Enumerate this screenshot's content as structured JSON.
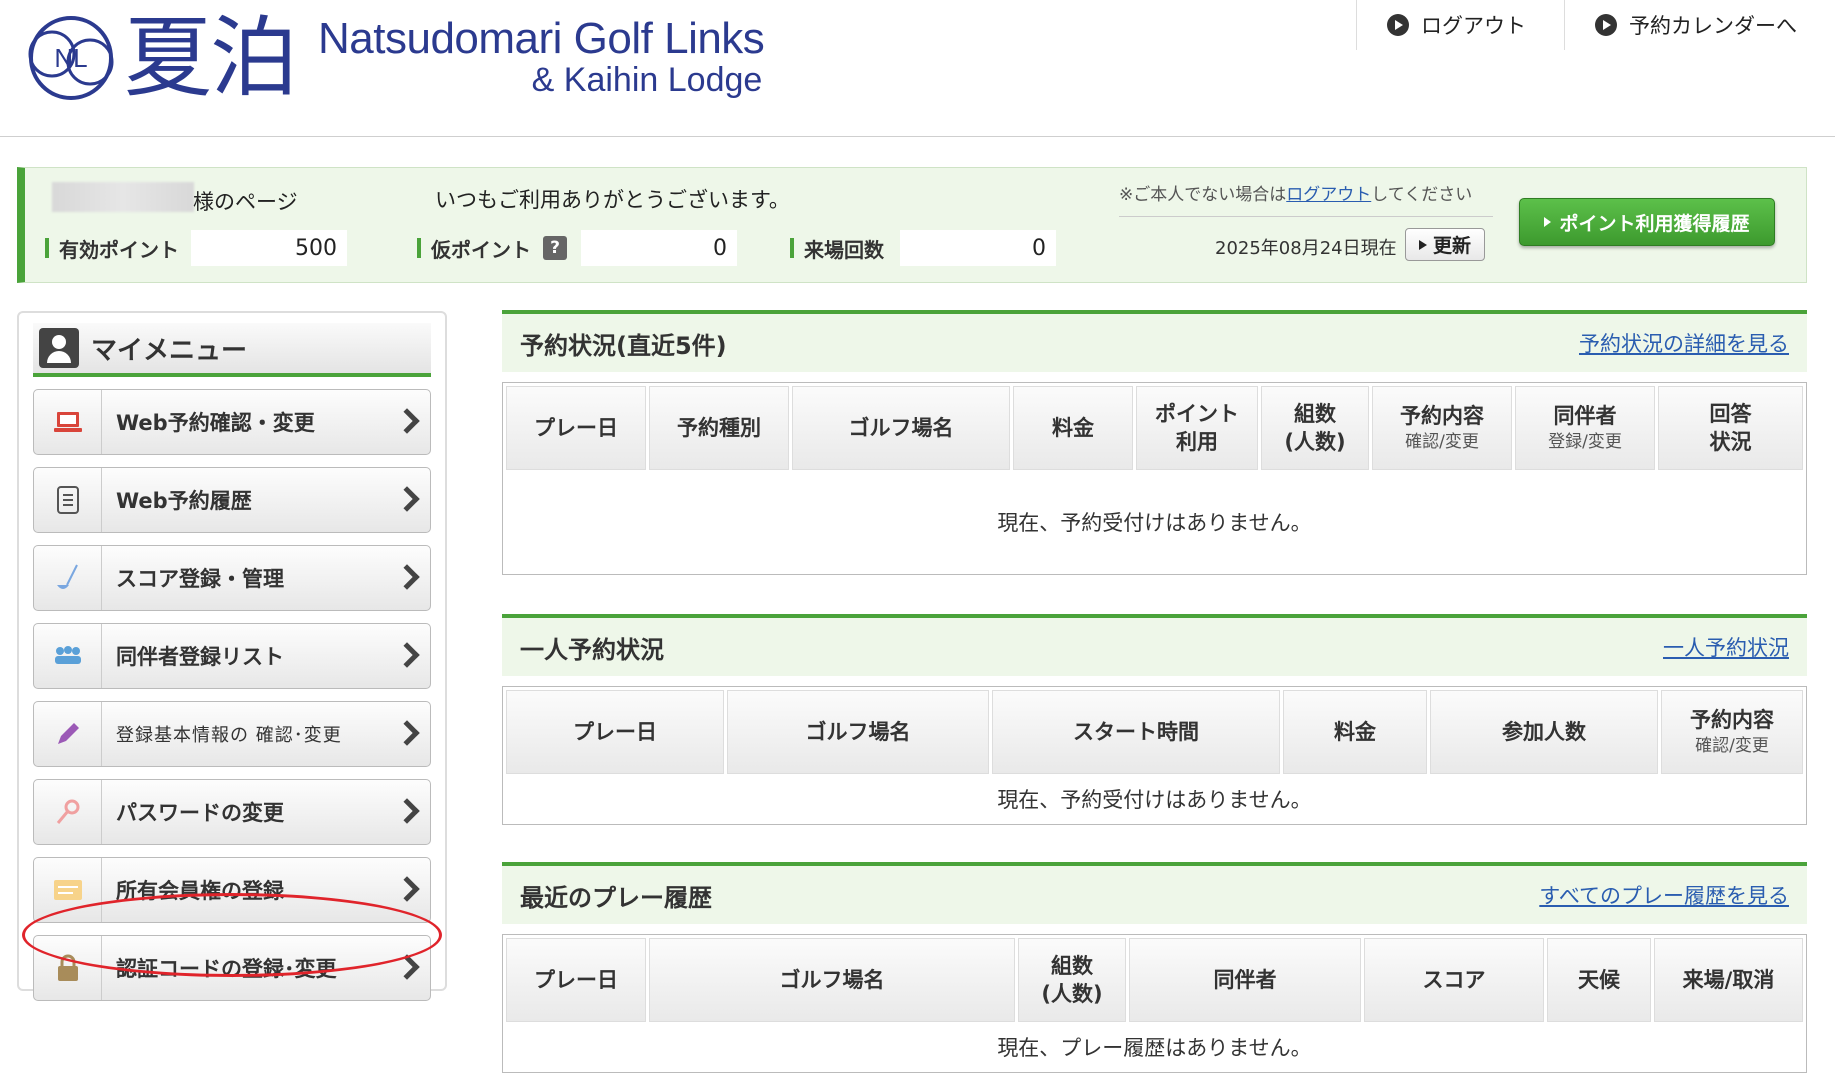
{
  "header": {
    "logo_mark": "NL",
    "logo_kanji": "夏泊",
    "logo_en_line1": "Natsudomari Golf Links",
    "logo_en_line2": "& Kaihin Lodge",
    "links": [
      {
        "label": "ログアウト",
        "icon": "play-circle-icon"
      },
      {
        "label": "予約カレンダーへ",
        "icon": "play-circle-icon"
      }
    ]
  },
  "info": {
    "user_suffix": "様のページ",
    "welcome": "いつもご利用ありがとうございます。",
    "note_prefix": "※ご本人でない場合は",
    "note_link": "ログアウト",
    "note_suffix": "してください",
    "points_label": "有効ポイント",
    "points_value": "500",
    "temp_points_label": "仮ポイント",
    "temp_points_help": "?",
    "temp_points_value": "0",
    "visits_label": "来場回数",
    "visits_value": "0",
    "as_of": "2025年08月24日現在",
    "refresh_label": "更新",
    "point_history_label": "ポイント利用獲得履歴",
    "accent_color": "#4aa33a"
  },
  "sidebar": {
    "title": "マイメニュー",
    "items": [
      {
        "label": "Web予約確認・変更",
        "icon": "laptop-icon"
      },
      {
        "label": "Web予約履歴",
        "icon": "document-list-icon"
      },
      {
        "label": "スコア登録・管理",
        "icon": "golf-club-icon"
      },
      {
        "label": "同伴者登録リスト",
        "icon": "people-group-icon"
      },
      {
        "label": "登録基本情報の 確認･変更",
        "icon": "pencil-icon"
      },
      {
        "label": "パスワードの変更",
        "icon": "key-icon"
      },
      {
        "label": "所有会員権の登録",
        "icon": "membership-card-icon"
      },
      {
        "label": "認証コードの登録･変更",
        "icon": "lock-icon"
      }
    ]
  },
  "reservations": {
    "title": "予約状況(直近5件)",
    "link": "予約状況の詳細を見る",
    "columns": [
      {
        "label": "プレー日"
      },
      {
        "label": "予約種別"
      },
      {
        "label": "ゴルフ場名"
      },
      {
        "label": "料金"
      },
      {
        "label": "ポイント",
        "label2": "利用"
      },
      {
        "label": "組数",
        "label2": "(人数)"
      },
      {
        "label": "予約内容",
        "sub": "確認/変更"
      },
      {
        "label": "同伴者",
        "sub": "登録/変更"
      },
      {
        "label": "回答",
        "label2": "状況"
      }
    ],
    "empty": "現在、予約受付けはありません。"
  },
  "solo": {
    "title": "一人予約状況",
    "link": "一人予約状況",
    "columns": [
      {
        "label": "プレー日"
      },
      {
        "label": "ゴルフ場名"
      },
      {
        "label": "スタート時間"
      },
      {
        "label": "料金"
      },
      {
        "label": "参加人数"
      },
      {
        "label": "予約内容",
        "sub": "確認/変更"
      }
    ],
    "empty": "現在、予約受付けはありません。"
  },
  "history": {
    "title": "最近のプレー履歴",
    "link": "すべてのプレー履歴を見る",
    "columns": [
      {
        "label": "プレー日"
      },
      {
        "label": "ゴルフ場名"
      },
      {
        "label": "組数",
        "label2": "(人数)"
      },
      {
        "label": "同伴者"
      },
      {
        "label": "スコア"
      },
      {
        "label": "天候"
      },
      {
        "label": "来場/取消"
      }
    ],
    "empty": "現在、プレー履歴はありません。"
  }
}
